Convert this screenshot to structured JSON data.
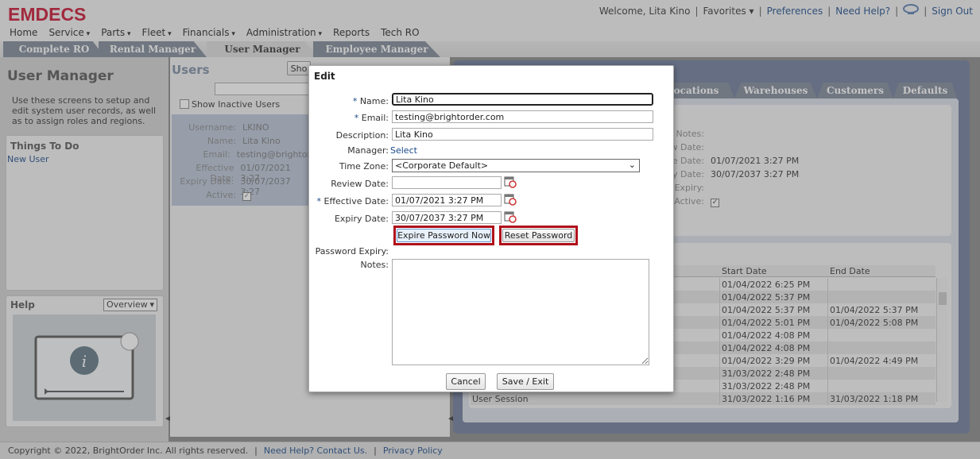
{
  "app": {
    "logo": "EMDECS"
  },
  "header": {
    "welcome": "Welcome, Lita Kino",
    "favorites": "Favorites",
    "preferences": "Preferences",
    "need_help": "Need Help?",
    "sign_out": "Sign Out"
  },
  "nav": [
    "Home",
    "Service",
    "Parts",
    "Fleet",
    "Financials",
    "Administration",
    "Reports",
    "Tech RO"
  ],
  "nav_dropdown": [
    false,
    true,
    true,
    true,
    true,
    true,
    false,
    false
  ],
  "tabs": [
    "Complete RO",
    "Rental Manager",
    "User Manager",
    "Employee Manager"
  ],
  "sidebar": {
    "title": "User Manager",
    "desc": "Use these screens to setup and edit system user records, as well as to assign roles and regions.",
    "things_title": "Things To Do",
    "new_user": "New User",
    "help_title": "Help",
    "help_select": "Overview"
  },
  "users": {
    "title": "Users",
    "show_btn": "Sho",
    "show_inactive": "Show Inactive Users",
    "labels": [
      "Username:",
      "Name:",
      "Email:",
      "Effective Date:",
      "Expiry Date:",
      "Active:"
    ],
    "values": [
      "LKINO",
      "Lita Kino",
      "testing@brightor",
      "01/07/2021 3:27",
      "30/07/2037 3:27",
      ""
    ]
  },
  "right": {
    "tabs": [
      "ocations",
      "Warehouses",
      "Customers",
      "Defaults"
    ],
    "labels": [
      "Notes:",
      "w Date:",
      "e Date:",
      "y Date:",
      "Expiry:",
      "Active:"
    ],
    "values": [
      "",
      "",
      "01/07/2021 3:27 PM",
      "30/07/2037 3:27 PM",
      "",
      ""
    ],
    "grid_headers": [
      "Start Date",
      "End Date"
    ],
    "grid": [
      [
        "",
        "01/04/2022 6:25 PM",
        ""
      ],
      [
        "",
        "01/04/2022 5:37 PM",
        ""
      ],
      [
        "",
        "01/04/2022 5:37 PM",
        "01/04/2022 5:37 PM"
      ],
      [
        "",
        "01/04/2022 5:01 PM",
        "01/04/2022 5:08 PM"
      ],
      [
        "",
        "01/04/2022 4:08 PM",
        ""
      ],
      [
        "",
        "01/04/2022 4:08 PM",
        ""
      ],
      [
        "",
        "01/04/2022 3:29 PM",
        "01/04/2022 4:49 PM"
      ],
      [
        "",
        "31/03/2022 2:48 PM",
        ""
      ],
      [
        "",
        "31/03/2022 2:48 PM",
        ""
      ],
      [
        "User Session",
        "31/03/2022 1:16 PM",
        "31/03/2022 1:18 PM"
      ]
    ]
  },
  "dialog": {
    "title": "Edit",
    "name_label": "Name:",
    "name_value": "Lita Kino",
    "email_label": "Email:",
    "email_value": "testing@brightorder.com",
    "desc_label": "Description:",
    "desc_value": "Lita Kino",
    "manager_label": "Manager:",
    "manager_link": "Select",
    "tz_label": "Time Zone:",
    "tz_value": "<Corporate Default>",
    "review_label": "Review Date:",
    "review_value": "",
    "eff_label": "Effective Date:",
    "eff_value": "01/07/2021 3:27 PM",
    "exp_label": "Expiry Date:",
    "exp_value": "30/07/2037 3:27 PM",
    "expire_btn": "Expire Password Now",
    "reset_btn": "Reset Password",
    "pwexp_label": "Password Expiry:",
    "notes_label": "Notes:",
    "cancel": "Cancel",
    "save": "Save / Exit",
    "required_mark": "*"
  },
  "footer": {
    "copyright": "Copyright © 2022, BrightOrder Inc. All rights reserved.",
    "contact": "Need Help? Contact Us.",
    "privacy": "Privacy Policy"
  },
  "colors": {
    "brand": "#c8102e",
    "link": "#1a4a8a",
    "highlight": "#b0101a",
    "tab": "#7d8797"
  }
}
